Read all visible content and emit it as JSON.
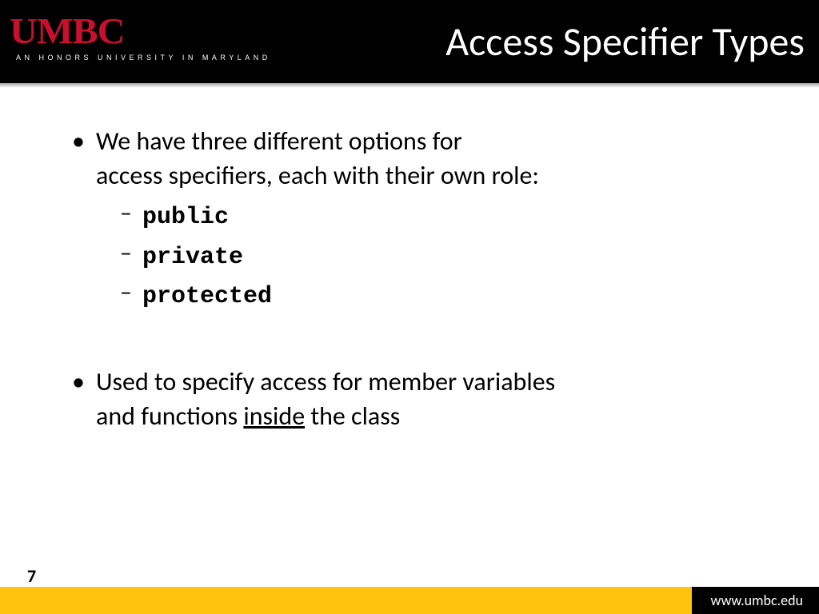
{
  "header": {
    "logo_text": "UMBC",
    "logo_tagline": "AN HONORS UNIVERSITY IN MARYLAND",
    "title": "Access Specifier Types"
  },
  "content": {
    "bullet1_line1": "We have three different options for",
    "bullet1_line2": "access specifiers, each with their own role:",
    "sub": {
      "a": "public",
      "b": "private",
      "c": "protected"
    },
    "bullet2_line1": "Used to specify access for member variables",
    "bullet2_line2a": "and functions ",
    "bullet2_underlined": "inside",
    "bullet2_line2b": " the class"
  },
  "footer": {
    "page": "7",
    "url": "www.umbc.edu"
  }
}
